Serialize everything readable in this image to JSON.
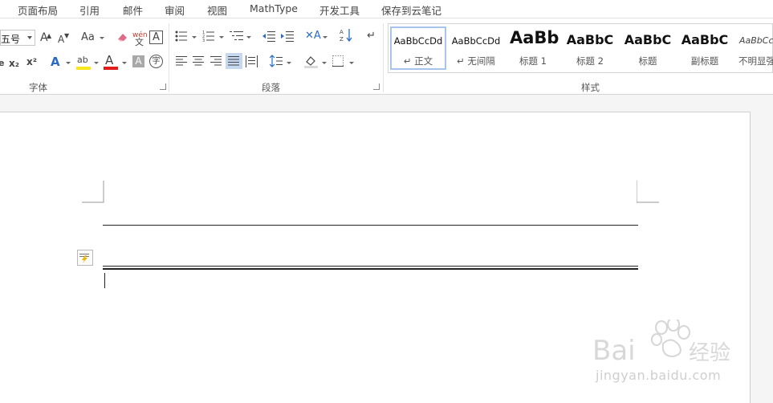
{
  "tabs": [
    "页面布局",
    "引用",
    "邮件",
    "审阅",
    "视图",
    "MathType",
    "开发工具",
    "保存到云笔记"
  ],
  "font_group": {
    "size_value": "五号",
    "label": "字体"
  },
  "paragraph_group": {
    "label": "段落"
  },
  "styles_group": {
    "label": "样式",
    "items": [
      {
        "sample": "AaBbCcDd",
        "name": "↵ 正文",
        "selected": true
      },
      {
        "sample": "AaBbCcDd",
        "name": "↵ 无间隔",
        "selected": false
      },
      {
        "sample": "AaBb",
        "name": "标题 1",
        "selected": false
      },
      {
        "sample": "AaBbC",
        "name": "标题 2",
        "selected": false
      },
      {
        "sample": "AaBbC",
        "name": "标题",
        "selected": false
      },
      {
        "sample": "AaBbC",
        "name": "副标题",
        "selected": false
      },
      {
        "sample": "AaBbCcDd",
        "name": "不明显强",
        "selected": false
      }
    ]
  },
  "icons": {
    "font_grow": "A",
    "font_shrink": "A",
    "change_case": "Aa",
    "clear_format": "eraser-icon",
    "phonetic": "wén",
    "char_border": "A",
    "subscript": "x₂",
    "superscript": "x²",
    "text_effect": "A",
    "highlight": "ab",
    "font_color": "A",
    "char_shading": "A",
    "enclose_char": "字"
  },
  "colors": {
    "accent_selected": "#a7c5eb",
    "highlight_yellow": "#f6e81a",
    "font_red": "#e21b1b",
    "justify_active": "#c5d8ef"
  },
  "watermark": {
    "brand": "Bai du 经验",
    "url": "jingyan.baidu.com"
  }
}
